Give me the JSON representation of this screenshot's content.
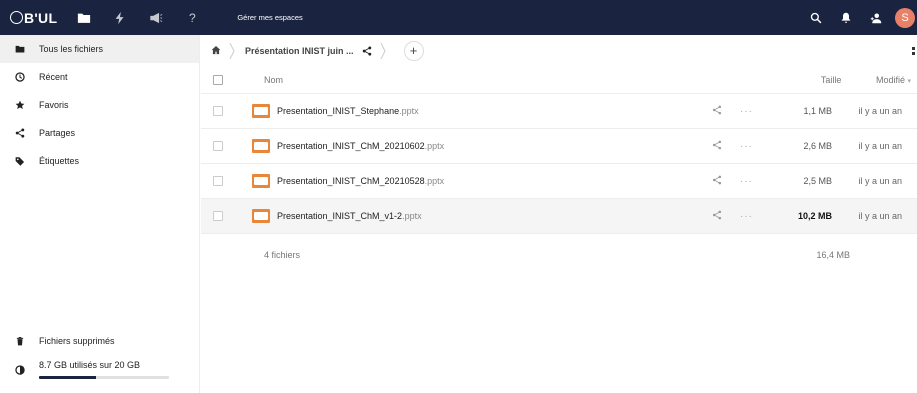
{
  "header": {
    "logo": "B'UL",
    "manage_spaces": "Gérer mes espaces",
    "avatar_letter": "S",
    "avatar_color": "#e98169",
    "bar_color": "#1a2441"
  },
  "sidebar": {
    "items": [
      {
        "label": "Tous les fichiers",
        "icon": "folder-icon"
      },
      {
        "label": "Récent",
        "icon": "clock-icon"
      },
      {
        "label": "Favoris",
        "icon": "star-icon"
      },
      {
        "label": "Partages",
        "icon": "share-icon"
      },
      {
        "label": "Étiquettes",
        "icon": "tag-icon"
      }
    ],
    "trash_label": "Fichiers supprimés",
    "quota_text": "8.7 GB utilisés sur 20 GB",
    "quota_fraction": 0.435
  },
  "breadcrumb": {
    "current": "Présentation INIST juin ...",
    "add_label": "+"
  },
  "table": {
    "header_name": "Nom",
    "header_size": "Taille",
    "header_modified": "Modifié",
    "files": [
      {
        "name": "Presentation_INIST_Stephane",
        "ext": ".pptx",
        "size": "1,1 MB",
        "modified": "il y a un an"
      },
      {
        "name": "Presentation_INIST_ChM_20210602",
        "ext": ".pptx",
        "size": "2,6 MB",
        "modified": "il y a un an"
      },
      {
        "name": "Presentation_INIST_ChM_20210528",
        "ext": ".pptx",
        "size": "2,5 MB",
        "modified": "il y a un an"
      },
      {
        "name": "Presentation_INIST_ChM_v1-2",
        "ext": ".pptx",
        "size": "10,2 MB",
        "modified": "il y a un an"
      }
    ],
    "more_label": "···",
    "summary_count": "4 fichiers",
    "summary_size": "16,4 MB"
  }
}
